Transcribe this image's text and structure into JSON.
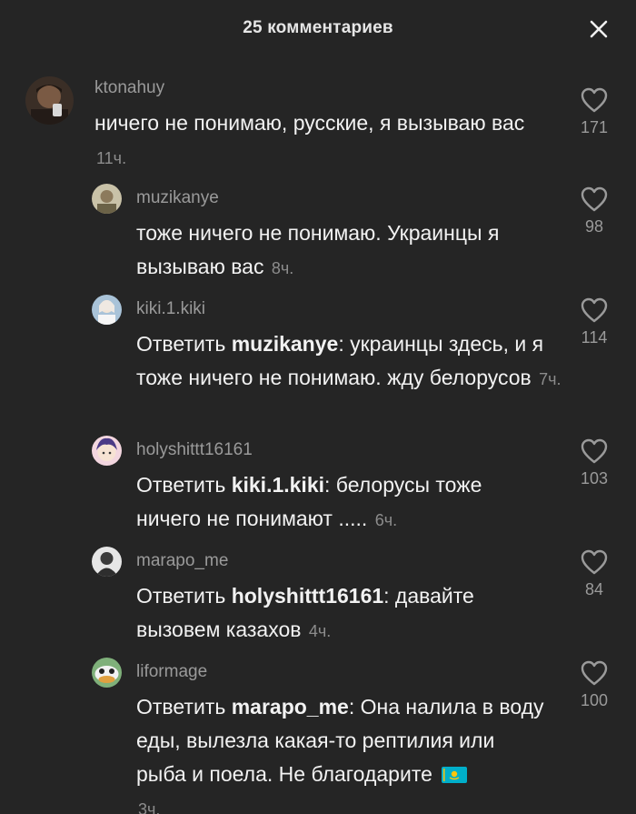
{
  "header": {
    "title": "25 комментариев",
    "close_icon": "close-icon"
  },
  "colors": {
    "background": "#252525",
    "text": "#f2f2f2",
    "muted": "#9a9a9a"
  },
  "comments": [
    {
      "username": "ktonahuy",
      "text": "ничего не понимаю, русские, я вызываю вас",
      "time": "11ч.",
      "likes": "171",
      "icon": "heart-outline-icon"
    },
    {
      "username": "muzikanye",
      "text": "тоже ничего не понимаю. Украинцы я вызываю вас",
      "time": "8ч.",
      "likes": "98",
      "icon": "heart-outline-icon"
    },
    {
      "username": "kiki.1.kiki",
      "reply_prefix": "Ответить",
      "reply_to": "muzikanye",
      "text": ": украинцы здесь, и я тоже ничего не понимаю. жду белорусов",
      "time": "7ч.",
      "likes": "114",
      "icon": "heart-outline-icon"
    },
    {
      "username": "holyshittt16161",
      "reply_prefix": "Ответить",
      "reply_to": "kiki.1.kiki",
      "text": ": белорусы тоже ничего не понимают .....",
      "time": "6ч.",
      "likes": "103",
      "icon": "heart-outline-icon"
    },
    {
      "username": "marapo_me",
      "reply_prefix": "Ответить",
      "reply_to": "holyshittt16161",
      "text": ": давайте вызовем казахов",
      "time": "4ч.",
      "likes": "84",
      "icon": "heart-outline-icon"
    },
    {
      "username": "liformage",
      "reply_prefix": "Ответить",
      "reply_to": "marapo_me",
      "text": ": Она налила в воду еды, вылезла какая-то рептилия или рыба и поела. Не благодарите",
      "emoji": "kazakhstan-flag-icon",
      "time": "3ч.",
      "likes": "100",
      "icon": "heart-outline-icon"
    }
  ]
}
